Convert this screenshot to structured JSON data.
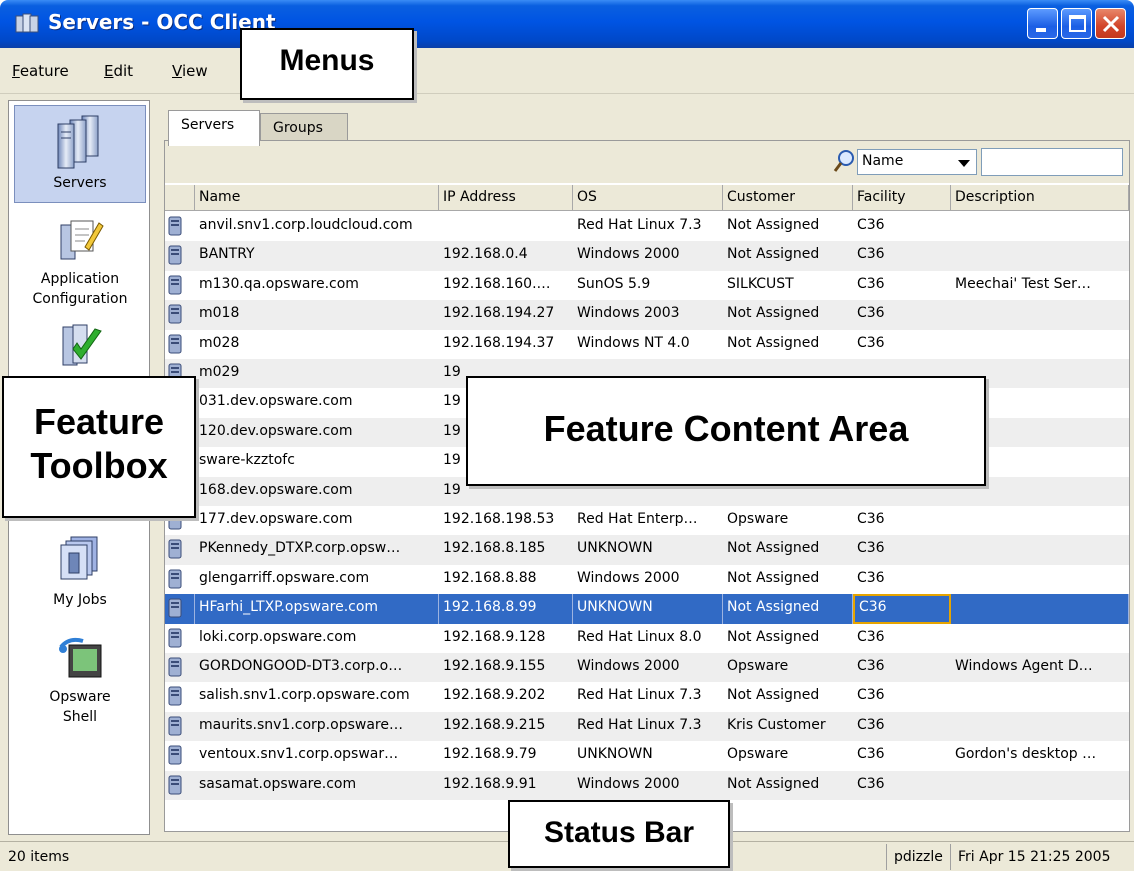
{
  "window": {
    "title": "Servers - OCC Client"
  },
  "menu": [
    "Feature",
    "Edit",
    "View"
  ],
  "toolbox": [
    {
      "label": "Servers",
      "icon": "servers-icon",
      "selected": true
    },
    {
      "label_lines": [
        "Application",
        "Configuration"
      ],
      "icon": "app-config-icon"
    },
    {
      "label": "",
      "icon": "compliance-check-icon"
    },
    {
      "label": "My Jobs",
      "icon": "my-jobs-icon"
    },
    {
      "label_lines": [
        "Opsware",
        "Shell"
      ],
      "icon": "opsware-shell-icon"
    }
  ],
  "tabs": [
    {
      "label": "Servers",
      "active": true
    },
    {
      "label": "Groups",
      "active": false
    }
  ],
  "filter": {
    "field": "Name",
    "value": ""
  },
  "table": {
    "columns": [
      "Name",
      "IP Address",
      "OS",
      "Customer",
      "Facility",
      "Description"
    ],
    "rows": [
      [
        "anvil.snv1.corp.loudcloud.com",
        "",
        "Red Hat Linux 7.3",
        "Not Assigned",
        "C36",
        ""
      ],
      [
        "BANTRY",
        "192.168.0.4",
        "Windows 2000",
        "Not Assigned",
        "C36",
        ""
      ],
      [
        "m130.qa.opsware.com",
        "192.168.160.…",
        "SunOS 5.9",
        "SILKCUST",
        "C36",
        "Meechai' Test Ser…"
      ],
      [
        "m018",
        "192.168.194.27",
        "Windows 2003",
        "Not Assigned",
        "C36",
        ""
      ],
      [
        "m028",
        "192.168.194.37",
        "Windows NT 4.0",
        "Not Assigned",
        "C36",
        ""
      ],
      [
        "m029",
        "19",
        "",
        "",
        "",
        ""
      ],
      [
        "031.dev.opsware.com",
        "19",
        "",
        "",
        "",
        ""
      ],
      [
        "120.dev.opsware.com",
        "19",
        "",
        "",
        "",
        ""
      ],
      [
        "sware-kzztofc",
        "19",
        "",
        "",
        "",
        ""
      ],
      [
        "168.dev.opsware.com",
        "19",
        "",
        "",
        "",
        ""
      ],
      [
        "177.dev.opsware.com",
        "192.168.198.53",
        "Red Hat Enterp…",
        "Opsware",
        "C36",
        ""
      ],
      [
        "PKennedy_DTXP.corp.opsw…",
        "192.168.8.185",
        "UNKNOWN",
        "Not Assigned",
        "C36",
        ""
      ],
      [
        "glengarriff.opsware.com",
        "192.168.8.88",
        "Windows 2000",
        "Not Assigned",
        "C36",
        ""
      ],
      [
        "HFarhi_LTXP.opsware.com",
        "192.168.8.99",
        "UNKNOWN",
        "Not Assigned",
        "C36",
        ""
      ],
      [
        "loki.corp.opsware.com",
        "192.168.9.128",
        "Red Hat Linux 8.0",
        "Not Assigned",
        "C36",
        ""
      ],
      [
        "GORDONGOOD-DT3.corp.o…",
        "192.168.9.155",
        "Windows 2000",
        "Opsware",
        "C36",
        "Windows Agent D…"
      ],
      [
        "salish.snv1.corp.opsware.com",
        "192.168.9.202",
        "Red Hat Linux 7.3",
        "Not Assigned",
        "C36",
        ""
      ],
      [
        "maurits.snv1.corp.opsware…",
        "192.168.9.215",
        "Red Hat Linux 7.3",
        "Kris Customer",
        "C36",
        ""
      ],
      [
        "ventoux.snv1.corp.opswar…",
        "192.168.9.79",
        "UNKNOWN",
        "Opsware",
        "C36",
        "Gordon's desktop …"
      ],
      [
        "sasamat.opsware.com",
        "192.168.9.91",
        "Windows 2000",
        "Not Assigned",
        "C36",
        ""
      ]
    ],
    "selected_row": 13
  },
  "status": {
    "count": "20 items",
    "user": "pdizzle",
    "time": "Fri Apr 15 21:25 2005"
  },
  "callouts": {
    "menus": "Menus",
    "toolbox_lines": [
      "Feature",
      "Toolbox"
    ],
    "content": "Feature Content Area",
    "status": "Status Bar"
  },
  "colors": {
    "titlebar": "#0054e3",
    "selection": "#316ac5",
    "toolbox_selected": "#c6d3ef",
    "chrome": "#ece9d8"
  }
}
